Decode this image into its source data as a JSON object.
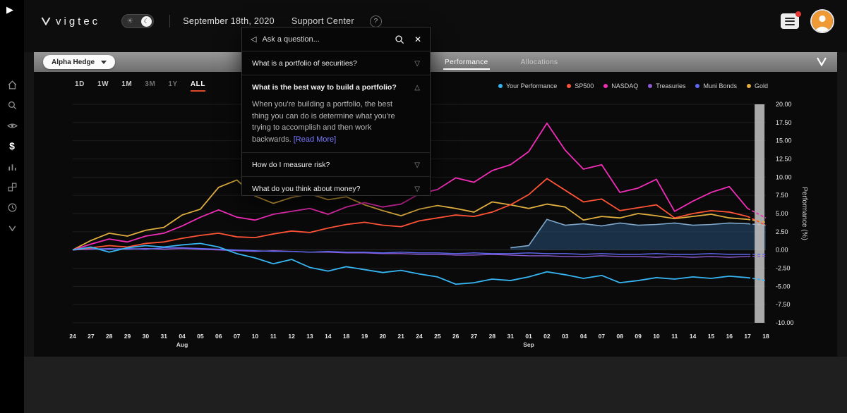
{
  "sidebar": {
    "icons": [
      "play",
      "home",
      "search",
      "eye",
      "dollar",
      "bar-chart",
      "blocks",
      "history-clock",
      "vigtec-mark"
    ]
  },
  "topbar": {
    "logo": "vigtec",
    "date": "September 18th, 2020",
    "support_center": "Support Center",
    "help": "?"
  },
  "strategy_bar": {
    "selected_strategy": "Alpha Hedge",
    "tabs": [
      {
        "label": "Performance",
        "active": true
      },
      {
        "label": "Allocations",
        "active": false
      }
    ]
  },
  "qa_modal": {
    "placeholder": "Ask a question...",
    "items": [
      {
        "question": "What is a portfolio of securities?",
        "expanded": false
      },
      {
        "question": "What is the best way to build a portfolio?",
        "expanded": true,
        "answer": "When you're building a portfolio, the best thing you can do is determine what you're trying to accomplish and then work backwards.",
        "read_more": "[Read More]"
      },
      {
        "question": "How do I measure risk?",
        "expanded": false
      },
      {
        "question": "What do you think about money?",
        "expanded": false
      }
    ]
  },
  "controls": {
    "active_underline_color": "#dd4a2b",
    "ranges": [
      {
        "label": "1D",
        "state": "normal"
      },
      {
        "label": "1W",
        "state": "normal"
      },
      {
        "label": "1M",
        "state": "normal"
      },
      {
        "label": "3M",
        "state": "dim"
      },
      {
        "label": "1Y",
        "state": "dim"
      },
      {
        "label": "ALL",
        "state": "active"
      }
    ]
  },
  "chart_data": {
    "type": "line",
    "title": "",
    "xlabel": "",
    "ylabel": "Performance (%)",
    "ylim": [
      -10,
      20
    ],
    "ytick_step": 2.5,
    "grid": true,
    "legend_position": "top-right",
    "x": [
      "24",
      "27",
      "28",
      "29",
      "30",
      "31",
      "04",
      "05",
      "06",
      "07",
      "10",
      "11",
      "12",
      "13",
      "14",
      "18",
      "19",
      "20",
      "21",
      "24",
      "25",
      "26",
      "27",
      "28",
      "31",
      "01",
      "02",
      "03",
      "04",
      "07",
      "08",
      "09",
      "10",
      "11",
      "14",
      "15",
      "16",
      "17",
      "18"
    ],
    "month_markers": [
      {
        "index": 6,
        "label": "Aug"
      },
      {
        "index": 25,
        "label": "Sep"
      }
    ],
    "series": [
      {
        "name": "Your Performance",
        "color": "#36b5f2",
        "width": 1.8,
        "last_dashed": true,
        "values": [
          0,
          0.4,
          -0.3,
          0.3,
          0.6,
          0.4,
          0.7,
          0.9,
          0.4,
          -0.5,
          -1.1,
          -1.9,
          -1.3,
          -2.4,
          -2.9,
          -2.3,
          -2.7,
          -3.1,
          -2.8,
          -3.3,
          -3.7,
          -4.7,
          -4.5,
          -4.0,
          -4.2,
          -3.7,
          -3.0,
          -3.4,
          -3.9,
          -3.5,
          -4.5,
          -4.2,
          -3.8,
          -4.0,
          -3.7,
          -3.9,
          -3.6,
          -3.8,
          -4.2
        ]
      },
      {
        "name": "SP500",
        "color": "#ff5336",
        "width": 1.8,
        "last_dashed": true,
        "values": [
          0,
          0.3,
          0.6,
          0.4,
          0.9,
          1.1,
          1.6,
          2.0,
          2.3,
          1.8,
          1.7,
          2.2,
          2.6,
          2.4,
          3.0,
          3.5,
          3.8,
          3.4,
          3.2,
          4.0,
          4.4,
          4.8,
          4.6,
          5.2,
          6.2,
          7.6,
          9.8,
          8.2,
          6.6,
          7.0,
          5.4,
          5.8,
          6.2,
          4.4,
          5.0,
          5.4,
          5.2,
          4.6,
          3.4
        ]
      },
      {
        "name": "NASDAQ",
        "color": "#f12db8",
        "width": 1.8,
        "last_dashed": true,
        "values": [
          0,
          0.8,
          1.5,
          1.1,
          1.9,
          2.3,
          3.3,
          4.5,
          5.5,
          4.5,
          4.1,
          4.9,
          5.3,
          5.7,
          4.9,
          5.9,
          6.5,
          5.9,
          6.3,
          7.7,
          8.3,
          9.9,
          9.3,
          10.9,
          11.7,
          13.5,
          17.4,
          13.7,
          11.1,
          11.7,
          7.9,
          8.5,
          9.7,
          5.3,
          6.7,
          7.9,
          8.7,
          5.7,
          4.4
        ]
      },
      {
        "name": "Treasuries",
        "color": "#8d5bd4",
        "width": 1.4,
        "last_dashed": true,
        "values": [
          0,
          0.1,
          0.2,
          0.1,
          0.2,
          0.1,
          0.2,
          0.1,
          0.0,
          -0.1,
          -0.2,
          -0.1,
          -0.2,
          -0.3,
          -0.3,
          -0.4,
          -0.4,
          -0.5,
          -0.5,
          -0.6,
          -0.6,
          -0.7,
          -0.7,
          -0.6,
          -0.7,
          -0.8,
          -0.8,
          -0.9,
          -0.9,
          -0.8,
          -0.9,
          -0.9,
          -1.0,
          -0.9,
          -1.0,
          -0.9,
          -1.0,
          -0.9,
          -0.9
        ]
      },
      {
        "name": "Muni Bonds",
        "color": "#5e6af2",
        "width": 1.4,
        "last_dashed": true,
        "values": [
          0,
          0.2,
          0.1,
          0.2,
          0.1,
          0.3,
          0.3,
          0.2,
          0.1,
          0.0,
          -0.1,
          -0.2,
          -0.2,
          -0.3,
          -0.2,
          -0.3,
          -0.3,
          -0.4,
          -0.3,
          -0.4,
          -0.4,
          -0.5,
          -0.4,
          -0.5,
          -0.5,
          -0.4,
          -0.5,
          -0.5,
          -0.6,
          -0.5,
          -0.6,
          -0.6,
          -0.5,
          -0.6,
          -0.6,
          -0.5,
          -0.6,
          -0.6,
          -0.6
        ]
      },
      {
        "name": "Gold",
        "color": "#dfae3e",
        "width": 1.8,
        "last_dashed": true,
        "values": [
          0,
          1.3,
          2.3,
          1.9,
          2.7,
          3.1,
          4.8,
          5.6,
          8.6,
          9.6,
          7.4,
          6.4,
          7.2,
          7.7,
          6.9,
          7.3,
          6.2,
          5.4,
          4.7,
          5.6,
          6.1,
          5.7,
          5.2,
          6.6,
          6.2,
          5.7,
          6.3,
          5.9,
          4.1,
          4.6,
          4.4,
          5.0,
          4.7,
          4.3,
          4.6,
          4.9,
          4.4,
          4.2,
          3.8
        ]
      }
    ],
    "highlight_band": {
      "name": "Hedged portfolio area",
      "color": "#7fa8cc",
      "fill": "rgba(40,86,130,0.5)",
      "baseline": 0,
      "start_index": 24,
      "values": [
        0.3,
        0.6,
        4.2,
        3.4,
        3.6,
        3.3,
        3.7,
        3.4,
        3.5,
        3.7,
        3.4,
        3.5,
        3.7,
        3.6,
        3.4
      ]
    },
    "current_column": {
      "from_index": 37,
      "to_index": 38,
      "color": "#c6c6c6"
    }
  }
}
